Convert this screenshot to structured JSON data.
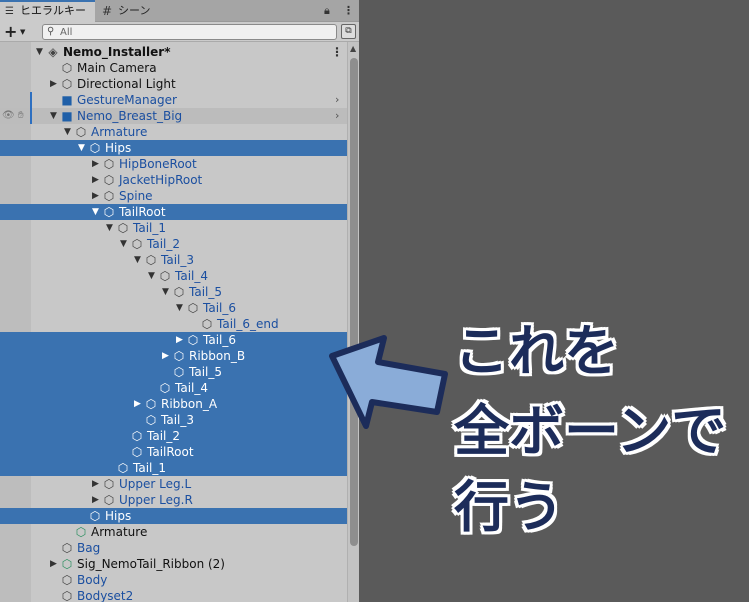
{
  "tabs": [
    {
      "label": "ヒエラルキー",
      "icon": "list-icon",
      "active": true
    },
    {
      "label": "シーン",
      "icon": "grid-icon",
      "active": false
    }
  ],
  "tabbar_icons": [
    "lock-icon",
    "kebab-icon"
  ],
  "toolbar": {
    "add_label": "+",
    "search_placeholder": "All"
  },
  "tree": [
    {
      "label": "Nemo_Installer*",
      "icon": "unity-scene-icon",
      "expanded": true,
      "root": true
    },
    {
      "label": "Main Camera",
      "icon": "cube-icon"
    },
    {
      "label": "Directional Light",
      "icon": "cube-icon",
      "collapsed": true
    },
    {
      "label": "GestureManager",
      "icon": "prefab-icon",
      "prefab": true,
      "chevron": true
    },
    {
      "label": "Nemo_Breast_Big",
      "icon": "prefab-icon",
      "prefab": true,
      "expanded": true,
      "chevron": true
    },
    {
      "label": "Armature",
      "icon": "cube-icon",
      "prefab": true,
      "expanded": true
    },
    {
      "label": "Hips",
      "icon": "cube-icon",
      "expanded": true,
      "selected": true
    },
    {
      "label": "HipBoneRoot",
      "icon": "cube-icon",
      "prefab": true,
      "collapsed": true
    },
    {
      "label": "JacketHipRoot",
      "icon": "cube-icon",
      "prefab": true,
      "collapsed": true
    },
    {
      "label": "Spine",
      "icon": "cube-icon",
      "prefab": true,
      "collapsed": true
    },
    {
      "label": "TailRoot",
      "icon": "cube-icon",
      "expanded": true,
      "selected": true
    },
    {
      "label": "Tail_1",
      "icon": "cube-icon",
      "prefab": true,
      "expanded": true
    },
    {
      "label": "Tail_2",
      "icon": "cube-icon",
      "prefab": true,
      "expanded": true
    },
    {
      "label": "Tail_3",
      "icon": "cube-icon",
      "prefab": true,
      "expanded": true
    },
    {
      "label": "Tail_4",
      "icon": "cube-icon",
      "prefab": true,
      "expanded": true
    },
    {
      "label": "Tail_5",
      "icon": "cube-icon",
      "prefab": true,
      "expanded": true
    },
    {
      "label": "Tail_6",
      "icon": "cube-icon",
      "prefab": true,
      "expanded": true
    },
    {
      "label": "Tail_6_end",
      "icon": "cube-icon",
      "prefab": true
    },
    {
      "label": "Tail_6",
      "icon": "cube-added-icon",
      "collapsed": true,
      "selected": true
    },
    {
      "label": "Ribbon_B",
      "icon": "cube-added-icon",
      "collapsed": true,
      "selected": true
    },
    {
      "label": "Tail_5",
      "icon": "cube-added-icon",
      "selected": true
    },
    {
      "label": "Tail_4",
      "icon": "cube-added-icon",
      "selected": true
    },
    {
      "label": "Ribbon_A",
      "icon": "cube-added-icon",
      "collapsed": true,
      "selected": true
    },
    {
      "label": "Tail_3",
      "icon": "cube-added-icon",
      "selected": true
    },
    {
      "label": "Tail_2",
      "icon": "cube-added-icon",
      "selected": true
    },
    {
      "label": "TailRoot",
      "icon": "cube-added-icon",
      "selected": true
    },
    {
      "label": "Tail_1",
      "icon": "cube-added-icon",
      "selected": true
    },
    {
      "label": "Upper Leg.L",
      "icon": "cube-icon",
      "prefab": true,
      "collapsed": true
    },
    {
      "label": "Upper Leg.R",
      "icon": "cube-icon",
      "prefab": true,
      "collapsed": true
    },
    {
      "label": "Hips",
      "icon": "cube-added-icon",
      "selected": true
    },
    {
      "label": "Armature",
      "icon": "cube-added-icon"
    },
    {
      "label": "Bag",
      "icon": "cube-icon",
      "prefab": true
    },
    {
      "label": "Sig_NemoTail_Ribbon (2)",
      "icon": "cube-added-icon",
      "collapsed": true
    },
    {
      "label": "Body",
      "icon": "cube-icon",
      "prefab": true
    },
    {
      "label": "Bodyset2",
      "icon": "cube-icon",
      "prefab": true
    }
  ],
  "annotation": {
    "lines": [
      "これを",
      "全ボーンで",
      "行う"
    ],
    "text_color": "#1c2c5a",
    "arrow_fill": "#8aacd8",
    "arrow_stroke": "#1c2c5a"
  },
  "colors": {
    "selection": "#3a72b0",
    "prefab_text": "#1b4fa0",
    "panel_bg": "#c8c8c8",
    "canvas_bg": "#5a5a5a"
  }
}
